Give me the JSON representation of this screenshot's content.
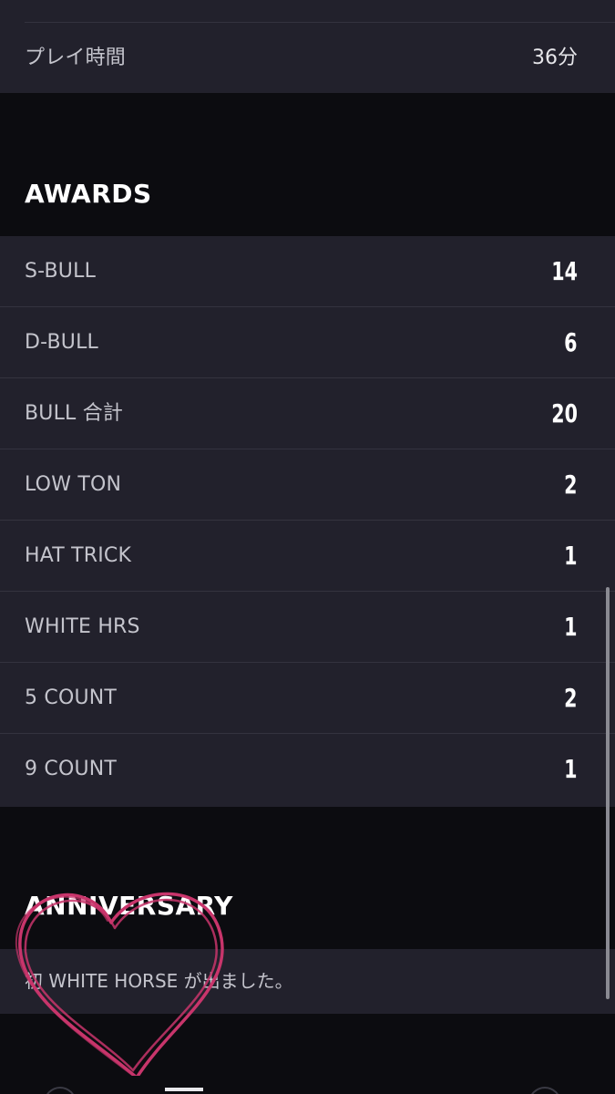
{
  "playtime": {
    "label": "プレイ時間",
    "value": "36分"
  },
  "awards": {
    "title": "AWARDS",
    "rows": [
      {
        "label": "S-BULL",
        "value": "14"
      },
      {
        "label": "D-BULL",
        "value": "6"
      },
      {
        "label": "BULL 合計",
        "value": "20"
      },
      {
        "label": "LOW TON",
        "value": "2"
      },
      {
        "label": "HAT TRICK",
        "value": "1"
      },
      {
        "label": "WHITE HRS",
        "value": "1"
      },
      {
        "label": "5 COUNT",
        "value": "2"
      },
      {
        "label": "9 COUNT",
        "value": "1"
      }
    ]
  },
  "anniversary": {
    "title": "ANNIVERSARY",
    "message": "初 WHITE HORSE が出ました。"
  },
  "overlay": {
    "icon": "heart-doodle-icon",
    "color": "#c8356b"
  },
  "colors": {
    "background": "#0c0c10",
    "card": "#22212c",
    "divider": "#34333f",
    "label": "#c4c4cc",
    "value": "#ffffff"
  }
}
